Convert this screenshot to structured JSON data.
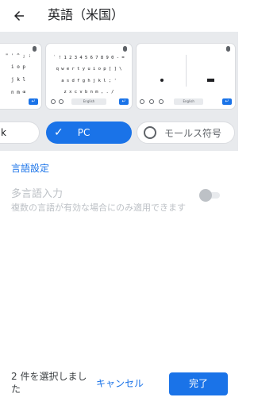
{
  "header": {
    "title": "英語（米国）"
  },
  "layouts": {
    "left_partial": {
      "chip_label": "k",
      "rows": [
        "\" ' ^ ; :",
        "i o p",
        "j k l",
        "n m ⌫"
      ]
    },
    "pc": {
      "chip_label": "PC",
      "rows": [
        "` ! 1 2 3 4 5 6 7 8 9 0 - =",
        "q w e r t y u i o p [ ] \\",
        "a s d f g h j k l ; '",
        "z x c v b n m , . /",
        "⇧ ☺ ⊕ English ↵"
      ],
      "spacebar": "English"
    },
    "morse": {
      "chip_label": "モールス符号",
      "spacebar": "English"
    }
  },
  "settings": {
    "language_settings": "言語設定",
    "multilingual_title": "多言語入力",
    "multilingual_subtitle": "複数の言語が有効な場合にのみ適用できます"
  },
  "footer": {
    "selected_count": "2 件を選択しました",
    "cancel": "キャンセル",
    "done": "完了"
  },
  "colors": {
    "accent": "#1a73e8",
    "disabled": "#bdc1c6",
    "carousel_bg": "#e8eaed"
  }
}
